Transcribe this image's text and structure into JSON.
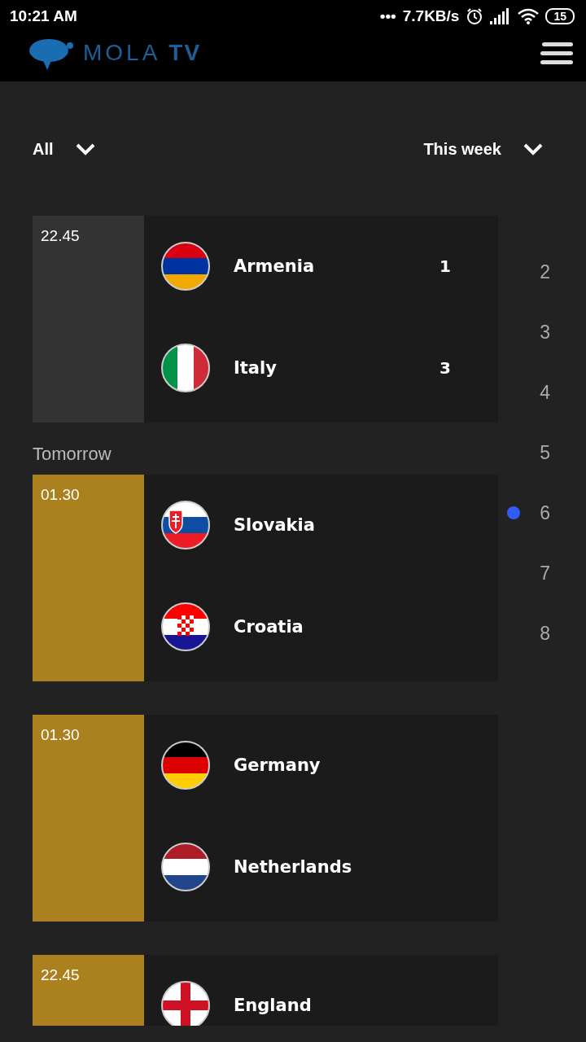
{
  "status_bar": {
    "time": "10:21 AM",
    "more": "•••",
    "speed": "7.7KB/s",
    "battery": "15"
  },
  "header": {
    "logo_left": "MOLA",
    "logo_right": "TV"
  },
  "filters": [
    {
      "label": "All"
    },
    {
      "label": "This week"
    }
  ],
  "sections": [
    {
      "matches": [
        {
          "time": "22.45",
          "kind": "finished",
          "teams": [
            {
              "name": "Armenia",
              "score": "1",
              "kind": "armenia"
            },
            {
              "name": "Italy",
              "score": "3",
              "kind": "italy"
            }
          ]
        }
      ]
    },
    {
      "label": "Tomorrow",
      "matches": [
        {
          "time": "01.30",
          "kind": "upcoming",
          "teams": [
            {
              "name": "Slovakia",
              "kind": "slovakia"
            },
            {
              "name": "Croatia",
              "kind": "croatia"
            }
          ]
        },
        {
          "time": "01.30",
          "kind": "upcoming",
          "teams": [
            {
              "name": "Germany",
              "kind": "germany"
            },
            {
              "name": "Netherlands",
              "kind": "netherlands"
            }
          ]
        },
        {
          "time": "22.45",
          "kind": "upcoming",
          "teams": [
            {
              "name": "England",
              "kind": "england"
            }
          ]
        }
      ]
    }
  ],
  "days": [
    {
      "label": "2",
      "selected": false
    },
    {
      "label": "3",
      "selected": false
    },
    {
      "label": "4",
      "selected": false
    },
    {
      "label": "5",
      "selected": false
    },
    {
      "label": "6",
      "selected": true
    },
    {
      "label": "7",
      "selected": false
    },
    {
      "label": "8",
      "selected": false
    }
  ]
}
